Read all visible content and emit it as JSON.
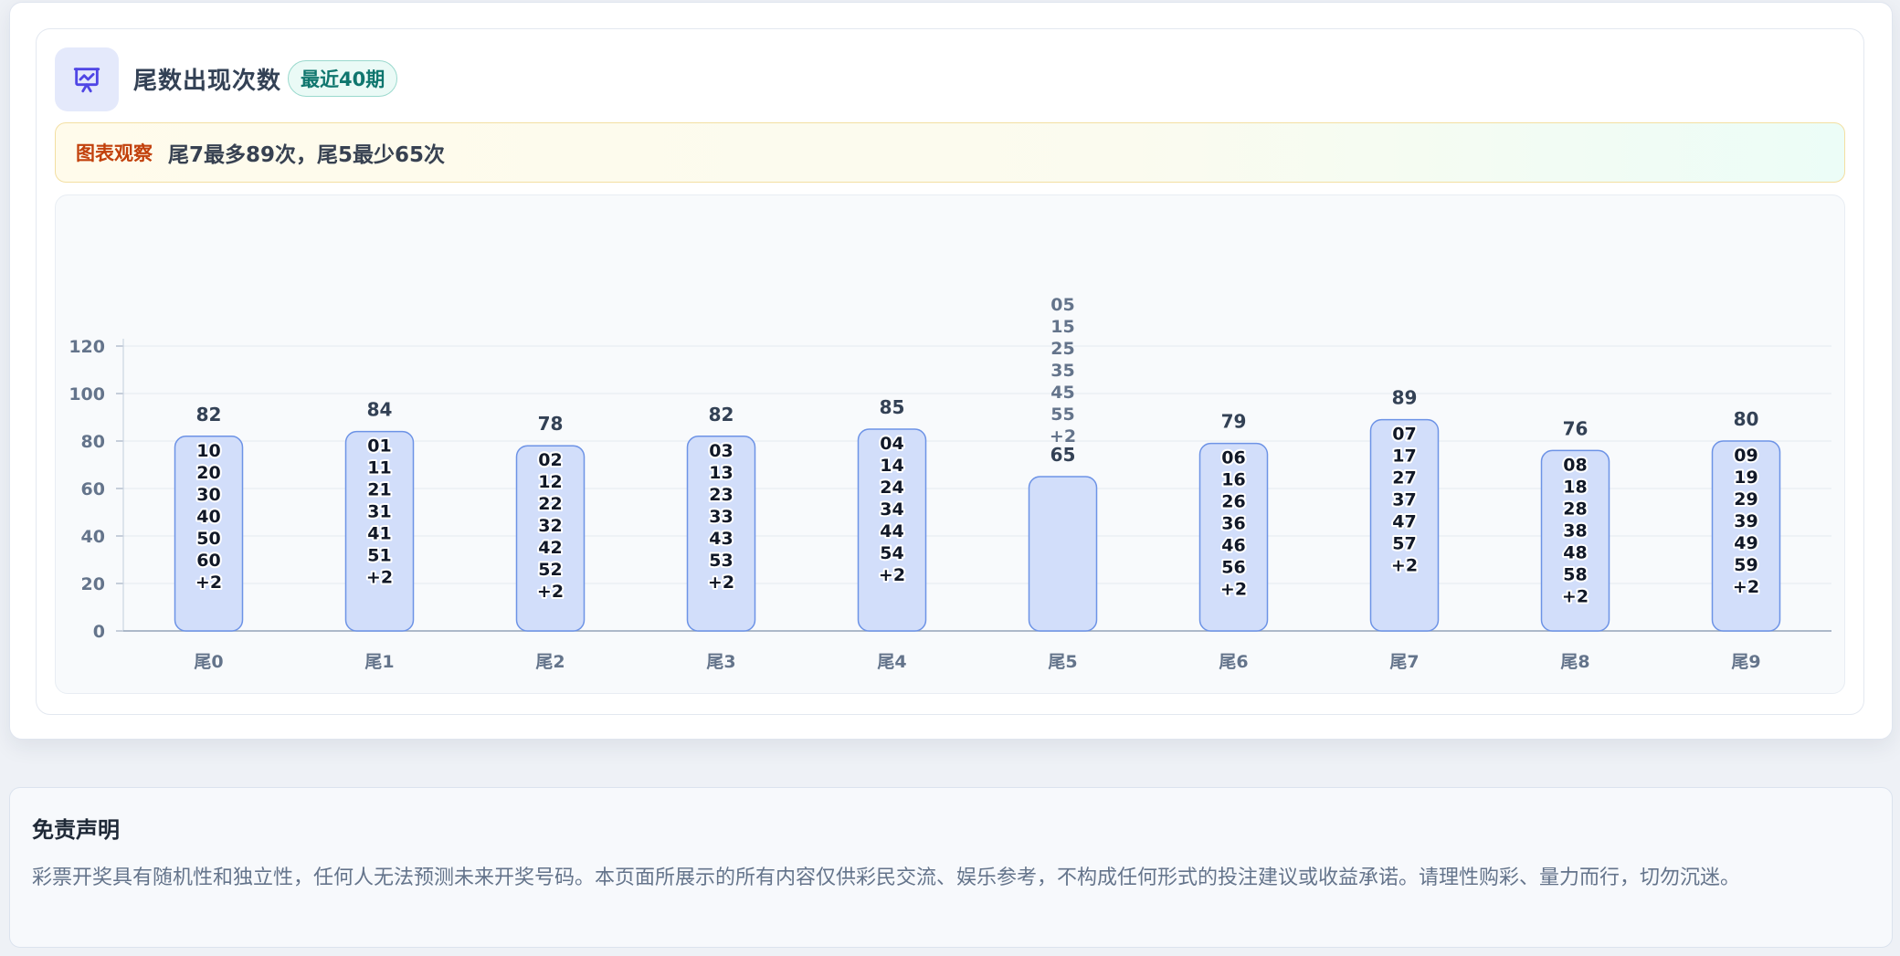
{
  "header": {
    "title": "尾数出现次数",
    "badge": "最近40期",
    "icon": "presentation-chart-icon"
  },
  "notice": {
    "label": "图表观察",
    "text": "尾7最多89次，尾5最少65次"
  },
  "chart_data": {
    "type": "bar",
    "categories": [
      "尾0",
      "尾1",
      "尾2",
      "尾3",
      "尾4",
      "尾5",
      "尾6",
      "尾7",
      "尾8",
      "尾9"
    ],
    "values": [
      82,
      84,
      78,
      82,
      85,
      65,
      79,
      89,
      76,
      80
    ],
    "ylim": [
      0,
      120
    ],
    "yticks": [
      0,
      20,
      40,
      60,
      80,
      100,
      120
    ],
    "grid": true,
    "bar_numbers": [
      [
        "10",
        "20",
        "30",
        "40",
        "50",
        "60",
        "+2"
      ],
      [
        "01",
        "11",
        "21",
        "31",
        "41",
        "51",
        "+2"
      ],
      [
        "02",
        "12",
        "22",
        "32",
        "42",
        "52",
        "+2"
      ],
      [
        "03",
        "13",
        "23",
        "33",
        "43",
        "53",
        "+2"
      ],
      [
        "04",
        "14",
        "24",
        "34",
        "44",
        "54",
        "+2"
      ],
      [
        "05",
        "15",
        "25",
        "35",
        "45",
        "55",
        "+2"
      ],
      [
        "06",
        "16",
        "26",
        "36",
        "46",
        "56",
        "+2"
      ],
      [
        "07",
        "17",
        "27",
        "37",
        "47",
        "57",
        "+2"
      ],
      [
        "08",
        "18",
        "28",
        "38",
        "48",
        "58",
        "+2"
      ],
      [
        "09",
        "19",
        "29",
        "39",
        "49",
        "59",
        "+2"
      ]
    ],
    "bar_color": "#d2defa",
    "bar_border": "#6d93e6"
  },
  "disclaimer": {
    "title": "免责声明",
    "text": "彩票开奖具有随机性和独立性，任何人无法预测未来开奖号码。本页面所展示的所有内容仅供彩民交流、娱乐参考，不构成任何形式的投注建议或收益承诺。请理性购彩、量力而行，切勿沉迷。"
  }
}
